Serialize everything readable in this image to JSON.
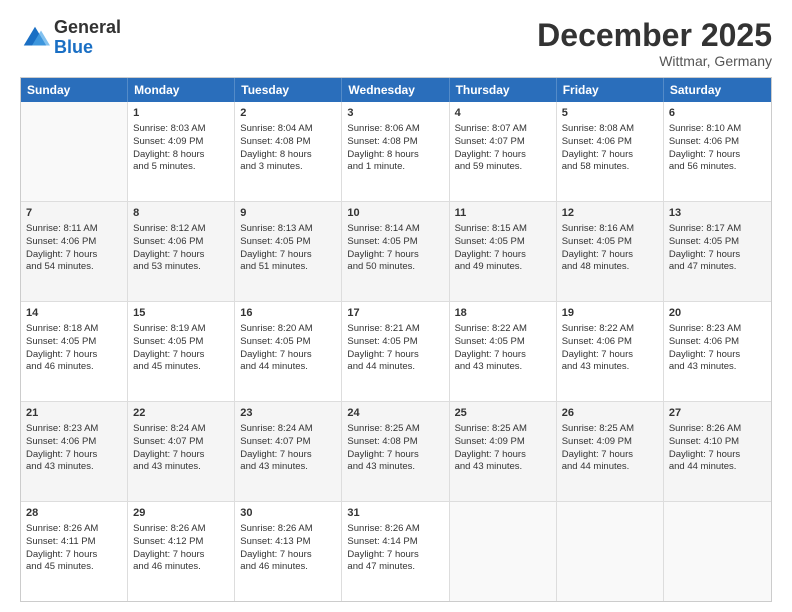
{
  "logo": {
    "general": "General",
    "blue": "Blue"
  },
  "title": "December 2025",
  "location": "Wittmar, Germany",
  "header_days": [
    "Sunday",
    "Monday",
    "Tuesday",
    "Wednesday",
    "Thursday",
    "Friday",
    "Saturday"
  ],
  "rows": [
    [
      {
        "day": "",
        "info": ""
      },
      {
        "day": "1",
        "info": "Sunrise: 8:03 AM\nSunset: 4:09 PM\nDaylight: 8 hours\nand 5 minutes."
      },
      {
        "day": "2",
        "info": "Sunrise: 8:04 AM\nSunset: 4:08 PM\nDaylight: 8 hours\nand 3 minutes."
      },
      {
        "day": "3",
        "info": "Sunrise: 8:06 AM\nSunset: 4:08 PM\nDaylight: 8 hours\nand 1 minute."
      },
      {
        "day": "4",
        "info": "Sunrise: 8:07 AM\nSunset: 4:07 PM\nDaylight: 7 hours\nand 59 minutes."
      },
      {
        "day": "5",
        "info": "Sunrise: 8:08 AM\nSunset: 4:06 PM\nDaylight: 7 hours\nand 58 minutes."
      },
      {
        "day": "6",
        "info": "Sunrise: 8:10 AM\nSunset: 4:06 PM\nDaylight: 7 hours\nand 56 minutes."
      }
    ],
    [
      {
        "day": "7",
        "info": "Sunrise: 8:11 AM\nSunset: 4:06 PM\nDaylight: 7 hours\nand 54 minutes."
      },
      {
        "day": "8",
        "info": "Sunrise: 8:12 AM\nSunset: 4:06 PM\nDaylight: 7 hours\nand 53 minutes."
      },
      {
        "day": "9",
        "info": "Sunrise: 8:13 AM\nSunset: 4:05 PM\nDaylight: 7 hours\nand 51 minutes."
      },
      {
        "day": "10",
        "info": "Sunrise: 8:14 AM\nSunset: 4:05 PM\nDaylight: 7 hours\nand 50 minutes."
      },
      {
        "day": "11",
        "info": "Sunrise: 8:15 AM\nSunset: 4:05 PM\nDaylight: 7 hours\nand 49 minutes."
      },
      {
        "day": "12",
        "info": "Sunrise: 8:16 AM\nSunset: 4:05 PM\nDaylight: 7 hours\nand 48 minutes."
      },
      {
        "day": "13",
        "info": "Sunrise: 8:17 AM\nSunset: 4:05 PM\nDaylight: 7 hours\nand 47 minutes."
      }
    ],
    [
      {
        "day": "14",
        "info": "Sunrise: 8:18 AM\nSunset: 4:05 PM\nDaylight: 7 hours\nand 46 minutes."
      },
      {
        "day": "15",
        "info": "Sunrise: 8:19 AM\nSunset: 4:05 PM\nDaylight: 7 hours\nand 45 minutes."
      },
      {
        "day": "16",
        "info": "Sunrise: 8:20 AM\nSunset: 4:05 PM\nDaylight: 7 hours\nand 44 minutes."
      },
      {
        "day": "17",
        "info": "Sunrise: 8:21 AM\nSunset: 4:05 PM\nDaylight: 7 hours\nand 44 minutes."
      },
      {
        "day": "18",
        "info": "Sunrise: 8:22 AM\nSunset: 4:05 PM\nDaylight: 7 hours\nand 43 minutes."
      },
      {
        "day": "19",
        "info": "Sunrise: 8:22 AM\nSunset: 4:06 PM\nDaylight: 7 hours\nand 43 minutes."
      },
      {
        "day": "20",
        "info": "Sunrise: 8:23 AM\nSunset: 4:06 PM\nDaylight: 7 hours\nand 43 minutes."
      }
    ],
    [
      {
        "day": "21",
        "info": "Sunrise: 8:23 AM\nSunset: 4:06 PM\nDaylight: 7 hours\nand 43 minutes."
      },
      {
        "day": "22",
        "info": "Sunrise: 8:24 AM\nSunset: 4:07 PM\nDaylight: 7 hours\nand 43 minutes."
      },
      {
        "day": "23",
        "info": "Sunrise: 8:24 AM\nSunset: 4:07 PM\nDaylight: 7 hours\nand 43 minutes."
      },
      {
        "day": "24",
        "info": "Sunrise: 8:25 AM\nSunset: 4:08 PM\nDaylight: 7 hours\nand 43 minutes."
      },
      {
        "day": "25",
        "info": "Sunrise: 8:25 AM\nSunset: 4:09 PM\nDaylight: 7 hours\nand 43 minutes."
      },
      {
        "day": "26",
        "info": "Sunrise: 8:25 AM\nSunset: 4:09 PM\nDaylight: 7 hours\nand 44 minutes."
      },
      {
        "day": "27",
        "info": "Sunrise: 8:26 AM\nSunset: 4:10 PM\nDaylight: 7 hours\nand 44 minutes."
      }
    ],
    [
      {
        "day": "28",
        "info": "Sunrise: 8:26 AM\nSunset: 4:11 PM\nDaylight: 7 hours\nand 45 minutes."
      },
      {
        "day": "29",
        "info": "Sunrise: 8:26 AM\nSunset: 4:12 PM\nDaylight: 7 hours\nand 46 minutes."
      },
      {
        "day": "30",
        "info": "Sunrise: 8:26 AM\nSunset: 4:13 PM\nDaylight: 7 hours\nand 46 minutes."
      },
      {
        "day": "31",
        "info": "Sunrise: 8:26 AM\nSunset: 4:14 PM\nDaylight: 7 hours\nand 47 minutes."
      },
      {
        "day": "",
        "info": ""
      },
      {
        "day": "",
        "info": ""
      },
      {
        "day": "",
        "info": ""
      }
    ]
  ]
}
